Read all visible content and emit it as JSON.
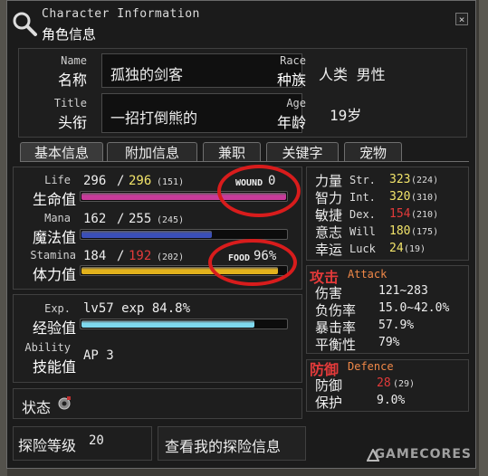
{
  "window": {
    "title_en": "Character Information",
    "title_zh": "角色信息",
    "close_label": "×"
  },
  "profile": {
    "name_en": "Name",
    "name_zh": "名称",
    "name_value": "孤独的剑客",
    "race_en": "Race",
    "race_zh": "种族",
    "race_value": "人类 男性",
    "title_en": "Title",
    "title_zh": "头衔",
    "title_value": "一招打倒熊的",
    "age_en": "Age",
    "age_zh": "年龄",
    "age_value": "19岁"
  },
  "tabs": [
    {
      "label": "基本信息"
    },
    {
      "label": "附加信息"
    },
    {
      "label": "兼职"
    },
    {
      "label": "关键字"
    },
    {
      "label": "宠物"
    }
  ],
  "vitals": {
    "life": {
      "en": "Life",
      "zh": "生命值",
      "current": "296",
      "max": "296",
      "max_sub": "(151)",
      "fill": 1.0,
      "extra_label": "WOUND",
      "extra_value": "0",
      "color": "#c83a9a"
    },
    "mana": {
      "en": "Mana",
      "zh": "魔法值",
      "current": "162",
      "max": "255",
      "max_sub": "(245)",
      "fill": 0.64,
      "color": "#3a4fb8"
    },
    "stamina": {
      "en": "Stamina",
      "zh": "体力值",
      "current": "184",
      "max": "192",
      "max_sub": "(202)",
      "fill": 0.96,
      "extra_label": "FOOD",
      "extra_value": "96%",
      "color": "#e2b21c"
    },
    "slash": "/"
  },
  "experience": {
    "en": "Exp.",
    "zh": "经验值",
    "text": "lv57 exp 84.8%",
    "fill": 0.848,
    "color": "#7ed8ee"
  },
  "ability": {
    "en": "Ability",
    "zh": "技能值",
    "text": "AP 3"
  },
  "status": {
    "zh": "状态"
  },
  "stats": [
    {
      "zh": "力量",
      "en": "Str.",
      "value": "323",
      "sub": "(224)",
      "color": "#f2e46a"
    },
    {
      "zh": "智力",
      "en": "Int.",
      "value": "320",
      "sub": "(310)",
      "color": "#f2e46a"
    },
    {
      "zh": "敏捷",
      "en": "Dex.",
      "value": "154",
      "sub": "(210)",
      "color": "#e23a3a"
    },
    {
      "zh": "意志",
      "en": "Will",
      "value": "180",
      "sub": "(175)",
      "color": "#f2e46a"
    },
    {
      "zh": "幸运",
      "en": "Luck",
      "value": "24",
      "sub": "(19)",
      "color": "#f2e46a"
    }
  ],
  "attack": {
    "header_zh": "攻击",
    "header_en": "Attack",
    "rows": [
      {
        "label": "伤害",
        "value": "121~283"
      },
      {
        "label": "负伤率",
        "value": "15.0~42.0%"
      },
      {
        "label": "暴击率",
        "value": "57.9%"
      },
      {
        "label": "平衡性",
        "value": "79%"
      }
    ]
  },
  "defence": {
    "header_zh": "防御",
    "header_en": "Defence",
    "rows": [
      {
        "label": "防御",
        "value": "28",
        "sub": "(29)"
      },
      {
        "label": "保护",
        "value": "9.0%"
      }
    ]
  },
  "bottom": {
    "rank_label": "探险等级",
    "rank_value": "20",
    "view_button": "查看我的探险信息"
  },
  "watermark": "GAMECORES"
}
